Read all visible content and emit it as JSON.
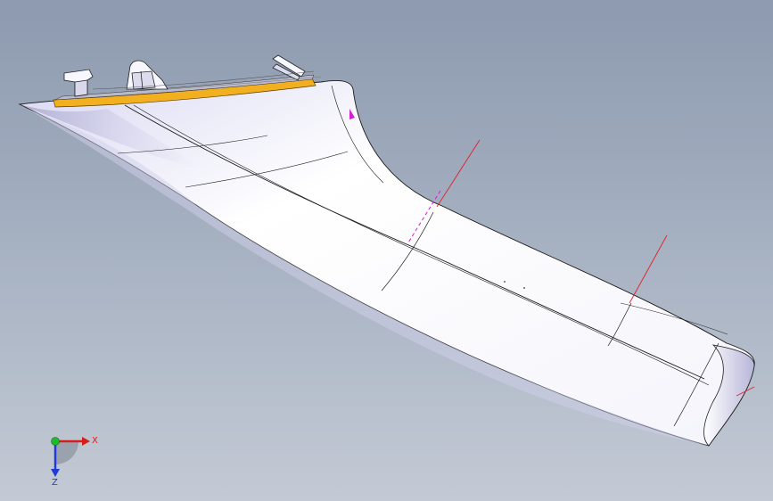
{
  "viewport": {
    "background_top": "#8d9aaf",
    "background_bottom": "#c3cad5",
    "part_color": "#ffffff",
    "trim_strip_color": "#f2b021",
    "edge_color": "#1a1a1a",
    "construction_line_color": "#e0202a",
    "marker_color": "#d21fd2"
  },
  "axis_triad": {
    "x_label": "X",
    "z_label": "Z",
    "x_color": "#d81c1c",
    "y_color": "#1dba2b",
    "z_color": "#1f3ad8"
  }
}
